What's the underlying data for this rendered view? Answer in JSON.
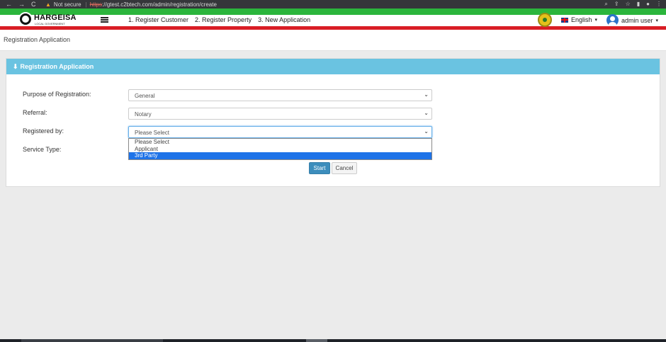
{
  "browser": {
    "back_icon": "←",
    "forward_icon": "→",
    "reload_icon": "C",
    "warning_icon": "▲",
    "not_secure": "Not secure",
    "separator": "|",
    "url_scheme": "https",
    "url_rest": "://gtest.c2btech.com/admin/registration/create",
    "right_icons": [
      "⌕",
      "⇪",
      "☆",
      "▮",
      "●",
      "⋮"
    ]
  },
  "header": {
    "brand": "HARGEISA",
    "brand_sub": "LOCAL GOVERNMENT",
    "nav": [
      "1. Register Customer",
      "2. Register Property",
      "3. New Application"
    ],
    "language": "English",
    "language_caret": "▾",
    "user": "admin user",
    "user_caret": "▾"
  },
  "page": {
    "title": "Registration Application"
  },
  "panel": {
    "header_icon": "⬇",
    "header": "Registration Application",
    "fields": {
      "purpose_label": "Purpose of Registration:",
      "purpose_value": "General",
      "referral_label": "Referral:",
      "referral_value": "Notary",
      "registered_by_label": "Registered by:",
      "registered_by_value": "Please Select",
      "service_type_label": "Service Type:"
    },
    "dropdown_options": [
      "Please Select",
      "Applicant",
      "3rd Party"
    ],
    "dropdown_selected_index": 2,
    "start_label": "Start",
    "cancel_label": "Cancel",
    "chevron": "⌄"
  },
  "colors": {
    "panel_header": "#6ac3e1",
    "green_stripe": "#2bb53c",
    "red_stripe": "#d91d25",
    "primary_button": "#3c8dbc",
    "selected_option": "#1e73e8"
  }
}
